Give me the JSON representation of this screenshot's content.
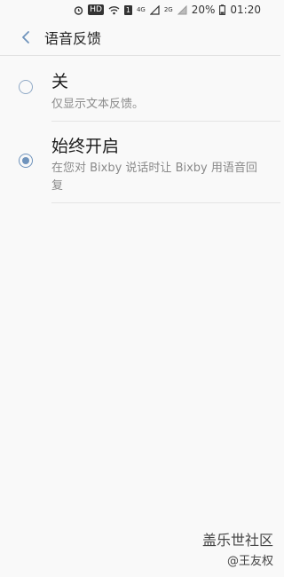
{
  "status_bar": {
    "hd": "HD",
    "net_4g": "4G",
    "net_2g": "2G",
    "sim": "1",
    "battery": "20%",
    "time": "01:20"
  },
  "header": {
    "title": "语音反馈"
  },
  "options": [
    {
      "title": "关",
      "subtitle": "仅显示文本反馈。",
      "selected": false
    },
    {
      "title": "始终开启",
      "subtitle": "在您对 Bixby 说话时让 Bixby 用语音回复",
      "selected": true
    }
  ],
  "colors": {
    "accent": "#6f93bc",
    "background": "#f9f9f9"
  },
  "watermark": {
    "brand": "盖乐世社区",
    "user": "@王友权"
  }
}
